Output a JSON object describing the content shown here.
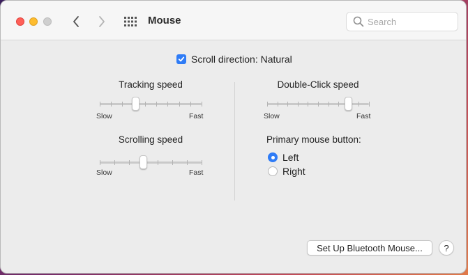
{
  "window": {
    "title": "Mouse"
  },
  "toolbar": {
    "back_icon": "chevron-left-icon",
    "forward_icon": "chevron-right-icon",
    "grid_icon": "show-all-grid-icon"
  },
  "search": {
    "placeholder": "Search",
    "value": ""
  },
  "scroll_direction": {
    "label": "Scroll direction: Natural",
    "checked": true
  },
  "tracking_speed": {
    "title": "Tracking speed",
    "min_label": "Slow",
    "max_label": "Fast",
    "ticks": 10,
    "value": 0.35
  },
  "scrolling_speed": {
    "title": "Scrolling speed",
    "min_label": "Slow",
    "max_label": "Fast",
    "ticks": 8,
    "value": 0.43
  },
  "double_click_speed": {
    "title": "Double-Click speed",
    "min_label": "Slow",
    "max_label": "Fast",
    "ticks": 11,
    "value": 0.8
  },
  "primary_button": {
    "label": "Primary mouse button:",
    "options": [
      {
        "label": "Left",
        "selected": true
      },
      {
        "label": "Right",
        "selected": false
      }
    ]
  },
  "buttons": {
    "bluetooth": "Set Up Bluetooth Mouse...",
    "help": "?"
  },
  "colors": {
    "accent": "#2f7cf6",
    "close": "#ff5f57",
    "minimize": "#febc2e",
    "zoom_inactive": "#cfcfcf"
  }
}
